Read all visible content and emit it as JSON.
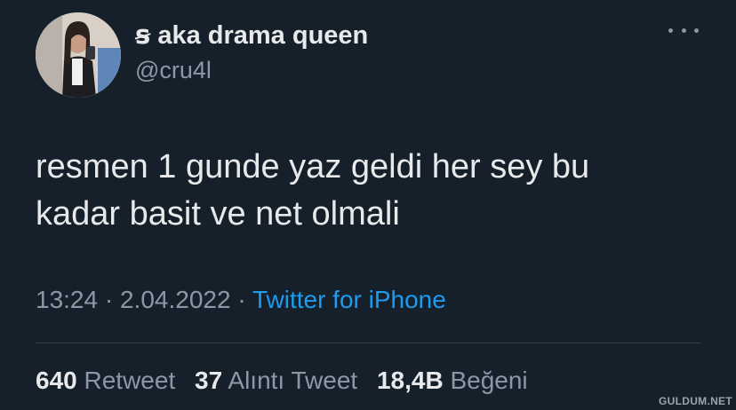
{
  "author": {
    "display_name": "ꞩ aka drama queen",
    "handle": "@cru4l",
    "avatar_icon": "profile-photo"
  },
  "tweet": {
    "text_line1": "resmen 1 gunde yaz geldi her sey bu",
    "text_line2": "kadar basit ve net olmali"
  },
  "meta": {
    "time": "13:24",
    "separator": "·",
    "date": "2.04.2022",
    "source": "Twitter for iPhone"
  },
  "stats": {
    "retweets": {
      "count": "640",
      "label": "Retweet"
    },
    "quotes": {
      "count": "37",
      "label": "Alıntı Tweet"
    },
    "likes": {
      "count": "18,4B",
      "label": "Beğeni"
    }
  },
  "watermark": "GULDUM.NET",
  "colors": {
    "background": "#15202b",
    "primary_text": "#e7e9ea",
    "secondary_text": "#8b98a5",
    "accent": "#1d9bf0"
  }
}
